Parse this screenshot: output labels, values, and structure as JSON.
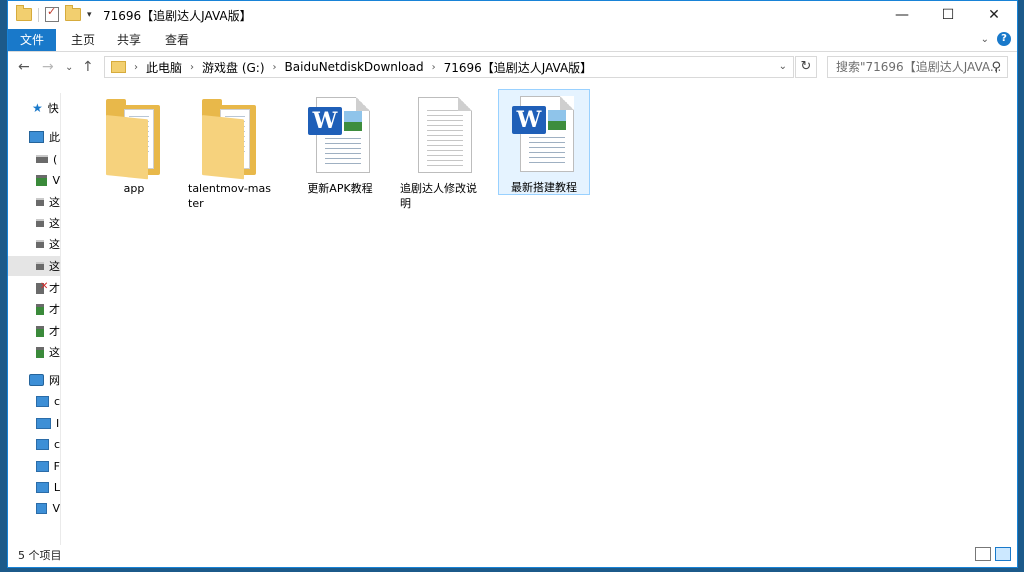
{
  "window": {
    "title": "71696【追剧达人JAVA版】",
    "controls": {
      "minimize": "—",
      "maximize": "☐",
      "close": "✕"
    }
  },
  "ribbon": {
    "tabs": [
      "文件",
      "主页",
      "共享",
      "查看"
    ]
  },
  "address": {
    "crumbs": [
      "此电脑",
      "游戏盘 (G:)",
      "BaiduNetdiskDownload",
      "71696【追剧达人JAVA版】"
    ],
    "search_placeholder": "搜索\"71696【追剧达人JAVA..."
  },
  "nav_pane": {
    "items": [
      {
        "label": "快",
        "icon": "quick-access-star-icon"
      },
      {
        "label": "此",
        "icon": "this-pc-icon"
      },
      {
        "label": "(",
        "icon": "drive-icon"
      },
      {
        "label": "V",
        "icon": "network-drive-icon"
      },
      {
        "label": "这",
        "icon": "drive-icon"
      },
      {
        "label": "这",
        "icon": "drive-icon"
      },
      {
        "label": "这",
        "icon": "drive-icon"
      },
      {
        "label": "这",
        "icon": "drive-icon",
        "selected": true
      },
      {
        "label": "才",
        "icon": "disconnected-drive-icon"
      },
      {
        "label": "才",
        "icon": "network-drive-icon"
      },
      {
        "label": "才",
        "icon": "network-drive-icon"
      },
      {
        "label": "这",
        "icon": "network-drive-icon"
      },
      {
        "label": "网",
        "icon": "network-icon"
      },
      {
        "label": "c",
        "icon": "computer-icon"
      },
      {
        "label": "I",
        "icon": "computer-icon"
      },
      {
        "label": "c",
        "icon": "computer-icon"
      },
      {
        "label": "F",
        "icon": "computer-icon"
      },
      {
        "label": "L",
        "icon": "computer-icon"
      },
      {
        "label": "V",
        "icon": "computer-icon"
      }
    ]
  },
  "files": [
    {
      "name": "app",
      "type": "folder"
    },
    {
      "name": "talentmov-master",
      "type": "folder"
    },
    {
      "name": "更新APK教程",
      "type": "word-doc"
    },
    {
      "name": "追剧达人修改说明",
      "type": "text-doc"
    },
    {
      "name": "最新搭建教程",
      "type": "word-doc",
      "selected": true
    }
  ],
  "status": {
    "item_count": "5 个项目"
  }
}
